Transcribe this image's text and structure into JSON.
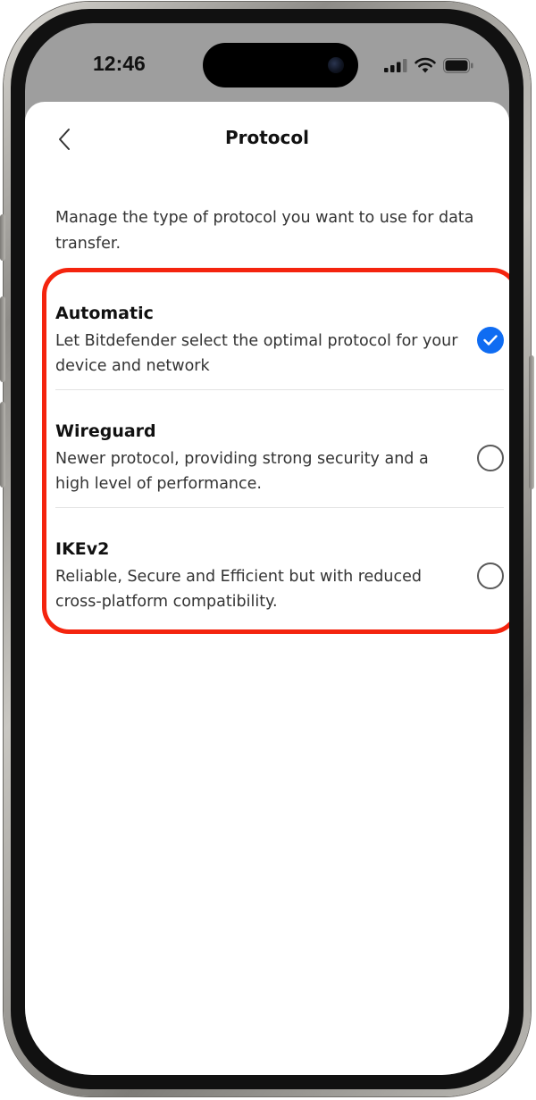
{
  "status_bar": {
    "time": "12:46",
    "icons": [
      "signal-icon",
      "wifi-icon",
      "battery-icon"
    ]
  },
  "header": {
    "title": "Protocol",
    "back_icon": "chevron-left-icon"
  },
  "description": "Manage the type of protocol you want to use for data transfer.",
  "options": [
    {
      "title": "Automatic",
      "subtitle": "Let Bitdefender select the optimal protocol for your device and network",
      "selected": true
    },
    {
      "title": "Wireguard",
      "subtitle": "Newer protocol, providing strong security and a high level of performance.",
      "selected": false
    },
    {
      "title": "IKEv2",
      "subtitle": "Reliable, Secure and Efficient but with reduced cross-platform compatibility.",
      "selected": false
    }
  ],
  "colors": {
    "accent": "#0f6cf2",
    "highlight": "#f4240e"
  }
}
